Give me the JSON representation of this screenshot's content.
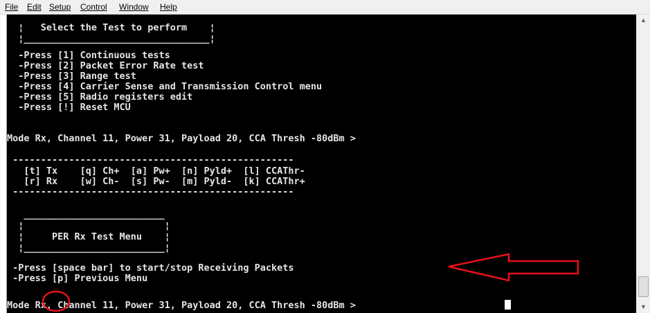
{
  "menu": [
    "File",
    "Edit",
    "Setup",
    "Control",
    "Window",
    "Help"
  ],
  "terminal_lines": [
    "  ¦   Select the Test to perform    ¦",
    "  ¦_________________________________¦",
    "  -Press [1] Continuous tests",
    "  -Press [2] Packet Error Rate test",
    "  -Press [3] Range test",
    "  -Press [4] Carrier Sense and Transmission Control menu",
    "  -Press [5] Radio registers edit",
    "  -Press [!] Reset MCU",
    "",
    "Mode Rx, Channel 11, Power 31, Payload 20, CCA Thresh -80dBm >",
    "",
    " --------------------------------------------------",
    "   [t] Tx    [q] Ch+  [a] Pw+  [n] Pyld+  [l] CCAThr-",
    "   [r] Rx    [w] Ch-  [s] Pw-  [m] Pyld-  [k] CCAThr+",
    " --------------------------------------------------",
    "",
    "   _________________________",
    "  ¦                         ¦",
    "  ¦     PER Rx Test Menu    ¦",
    "  ¦_________________________¦",
    "",
    " -Press [space bar] to start/stop Receiving Packets",
    " -Press [p] Previous Menu",
    "",
    "Mode Rx, Channel 11, Power 31, Payload 20, CCA Thresh -80dBm >"
  ],
  "annotation_color": "#e8101c",
  "scrollbar": {
    "up": "up-arrow-icon",
    "down": "down-arrow-icon"
  }
}
